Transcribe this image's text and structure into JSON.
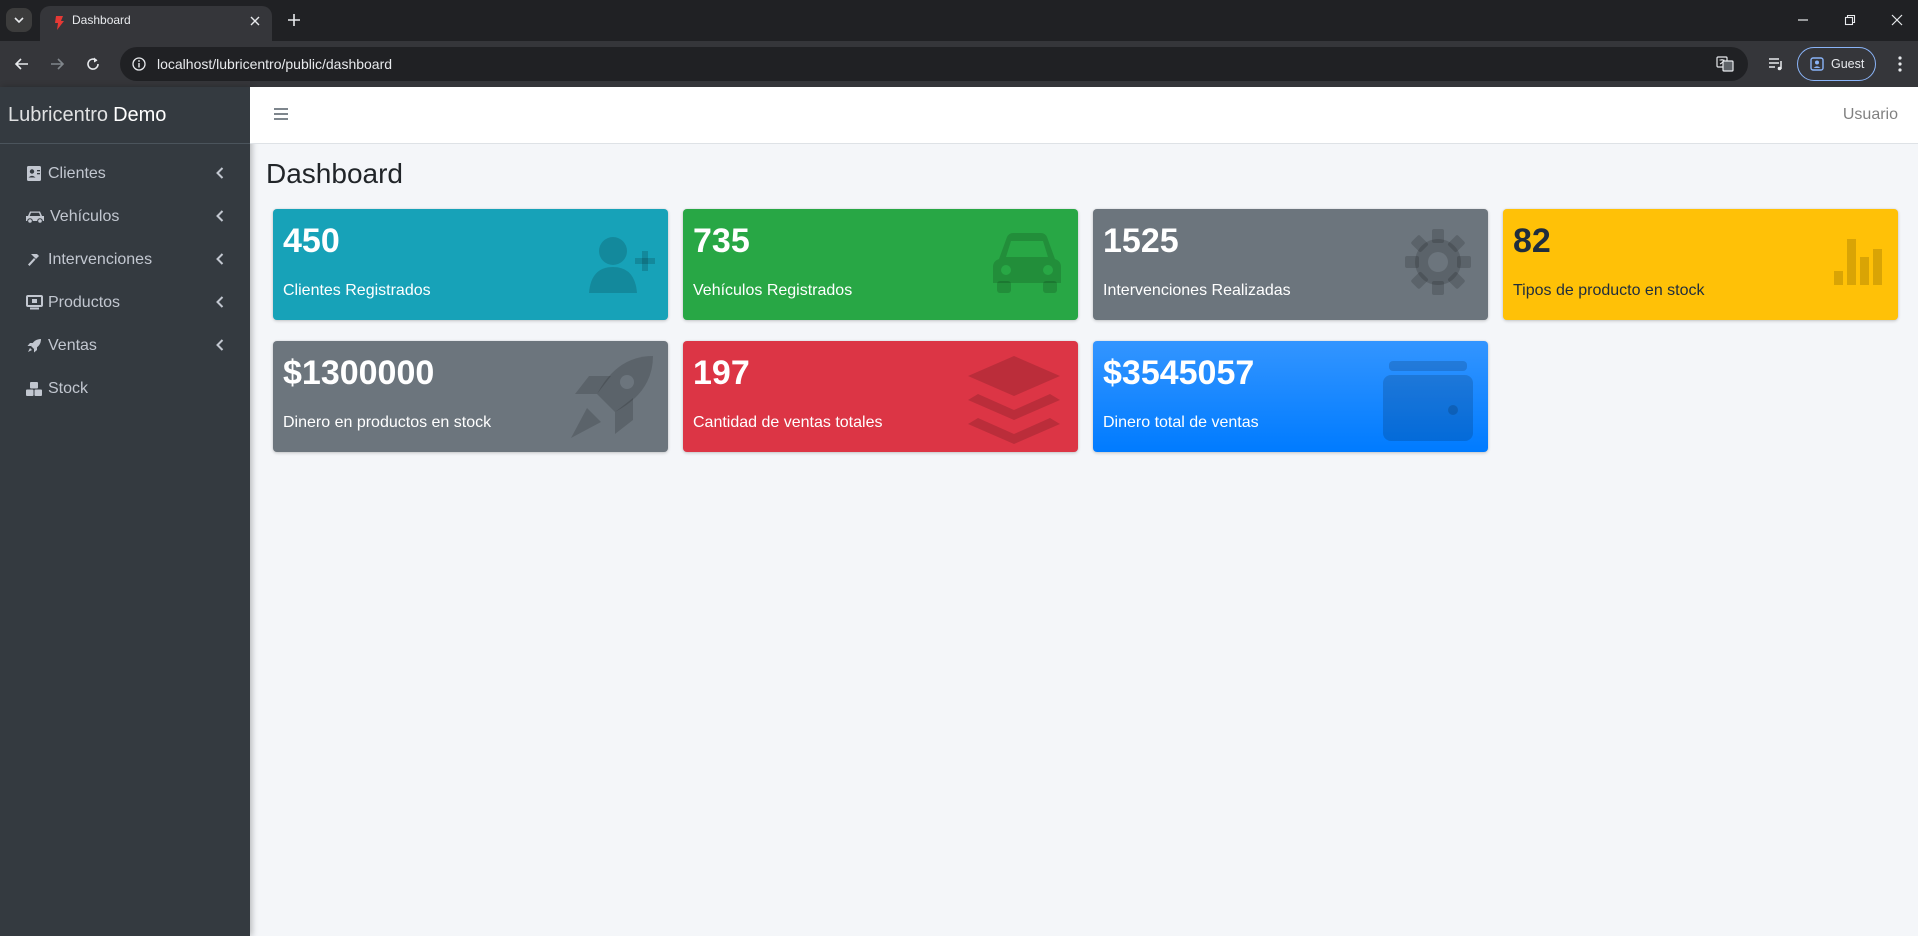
{
  "browser": {
    "tab_title": "Dashboard",
    "url": "localhost/lubricentro/public/dashboard",
    "profile_label": "Guest"
  },
  "sidebar": {
    "brand_light": "Lubricentro",
    "brand_bold": "Demo",
    "items": [
      {
        "label": "Clientes",
        "icon": "address-card-icon",
        "has_submenu": true
      },
      {
        "label": "Vehículos",
        "icon": "car-icon",
        "has_submenu": true
      },
      {
        "label": "Intervenciones",
        "icon": "hammer-icon",
        "has_submenu": true
      },
      {
        "label": "Productos",
        "icon": "laptop-icon",
        "has_submenu": true
      },
      {
        "label": "Ventas",
        "icon": "rocket-icon",
        "has_submenu": true
      },
      {
        "label": "Stock",
        "icon": "boxes-icon",
        "has_submenu": false
      }
    ]
  },
  "navbar": {
    "user_label": "Usuario"
  },
  "page": {
    "title": "Dashboard"
  },
  "cards": [
    {
      "value": "450",
      "label": "Clientes Registrados",
      "color": "#17a2b8",
      "icon": "user-plus-icon"
    },
    {
      "value": "735",
      "label": "Vehículos Registrados",
      "color": "#28a745",
      "icon": "car-icon"
    },
    {
      "value": "1525",
      "label": "Intervenciones Realizadas",
      "color": "#6c757d",
      "icon": "gear-icon"
    },
    {
      "value": "82",
      "label": "Tipos de producto en stock",
      "color": "#ffc107",
      "icon": "bar-chart-icon"
    },
    {
      "value": "$1300000",
      "label": "Dinero en productos en stock",
      "color": "#6c757d",
      "icon": "rocket-icon"
    },
    {
      "value": "197",
      "label": "Cantidad de ventas totales",
      "color": "#dc3545",
      "icon": "layers-icon"
    },
    {
      "value": "$3545057",
      "label": "Dinero total de ventas",
      "color": "#007bff",
      "icon": "wallet-icon"
    }
  ]
}
